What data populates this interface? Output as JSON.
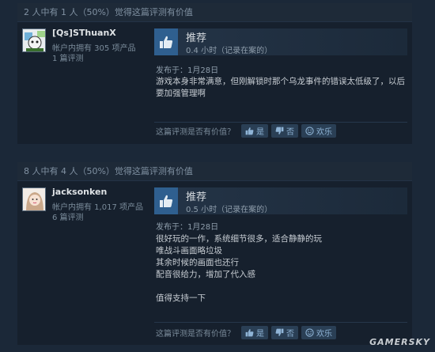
{
  "reviews": [
    {
      "helpful_summary": "2 人中有 1 人（50%）觉得这篇评测有价值",
      "author": {
        "name": "[Qs]SThuanX",
        "products": "帐户内拥有 305 项产品",
        "review_count": "1 篇评测"
      },
      "verdict": "推荐",
      "hours": "0.4 小时（记录在案的）",
      "posted": "发布于：1月28日",
      "body": [
        "游戏本身非常满意，但刚解锁时那个乌龙事件的错误太低级了，以后",
        "要加强管理啊"
      ],
      "helpful_question": "这篇评测是否有价值？",
      "buttons": {
        "yes": "是",
        "no": "否",
        "funny": "欢乐"
      }
    },
    {
      "helpful_summary": "8 人中有 4 人（50%）觉得这篇评测有价值",
      "author": {
        "name": "jacksonken",
        "products": "帐户内拥有 1,017 项产品",
        "review_count": "6 篇评测"
      },
      "verdict": "推荐",
      "hours": "0.5 小时（记录在案的）",
      "posted": "发布于：1月28日",
      "body": [
        "很好玩的一作，系统细节很多，适合静静的玩",
        "唯战斗画面略垃圾",
        "其余时候的画面也还行",
        "配音很给力，增加了代入感",
        "",
        "值得支持一下"
      ],
      "helpful_question": "这篇评测是否有价值？",
      "buttons": {
        "yes": "是",
        "no": "否",
        "funny": "欢乐"
      }
    }
  ],
  "watermark": "GAMERSKY",
  "colors": {
    "background": "#1b2838",
    "thumb": "#2f5f8f",
    "button": "#2a3f55"
  }
}
